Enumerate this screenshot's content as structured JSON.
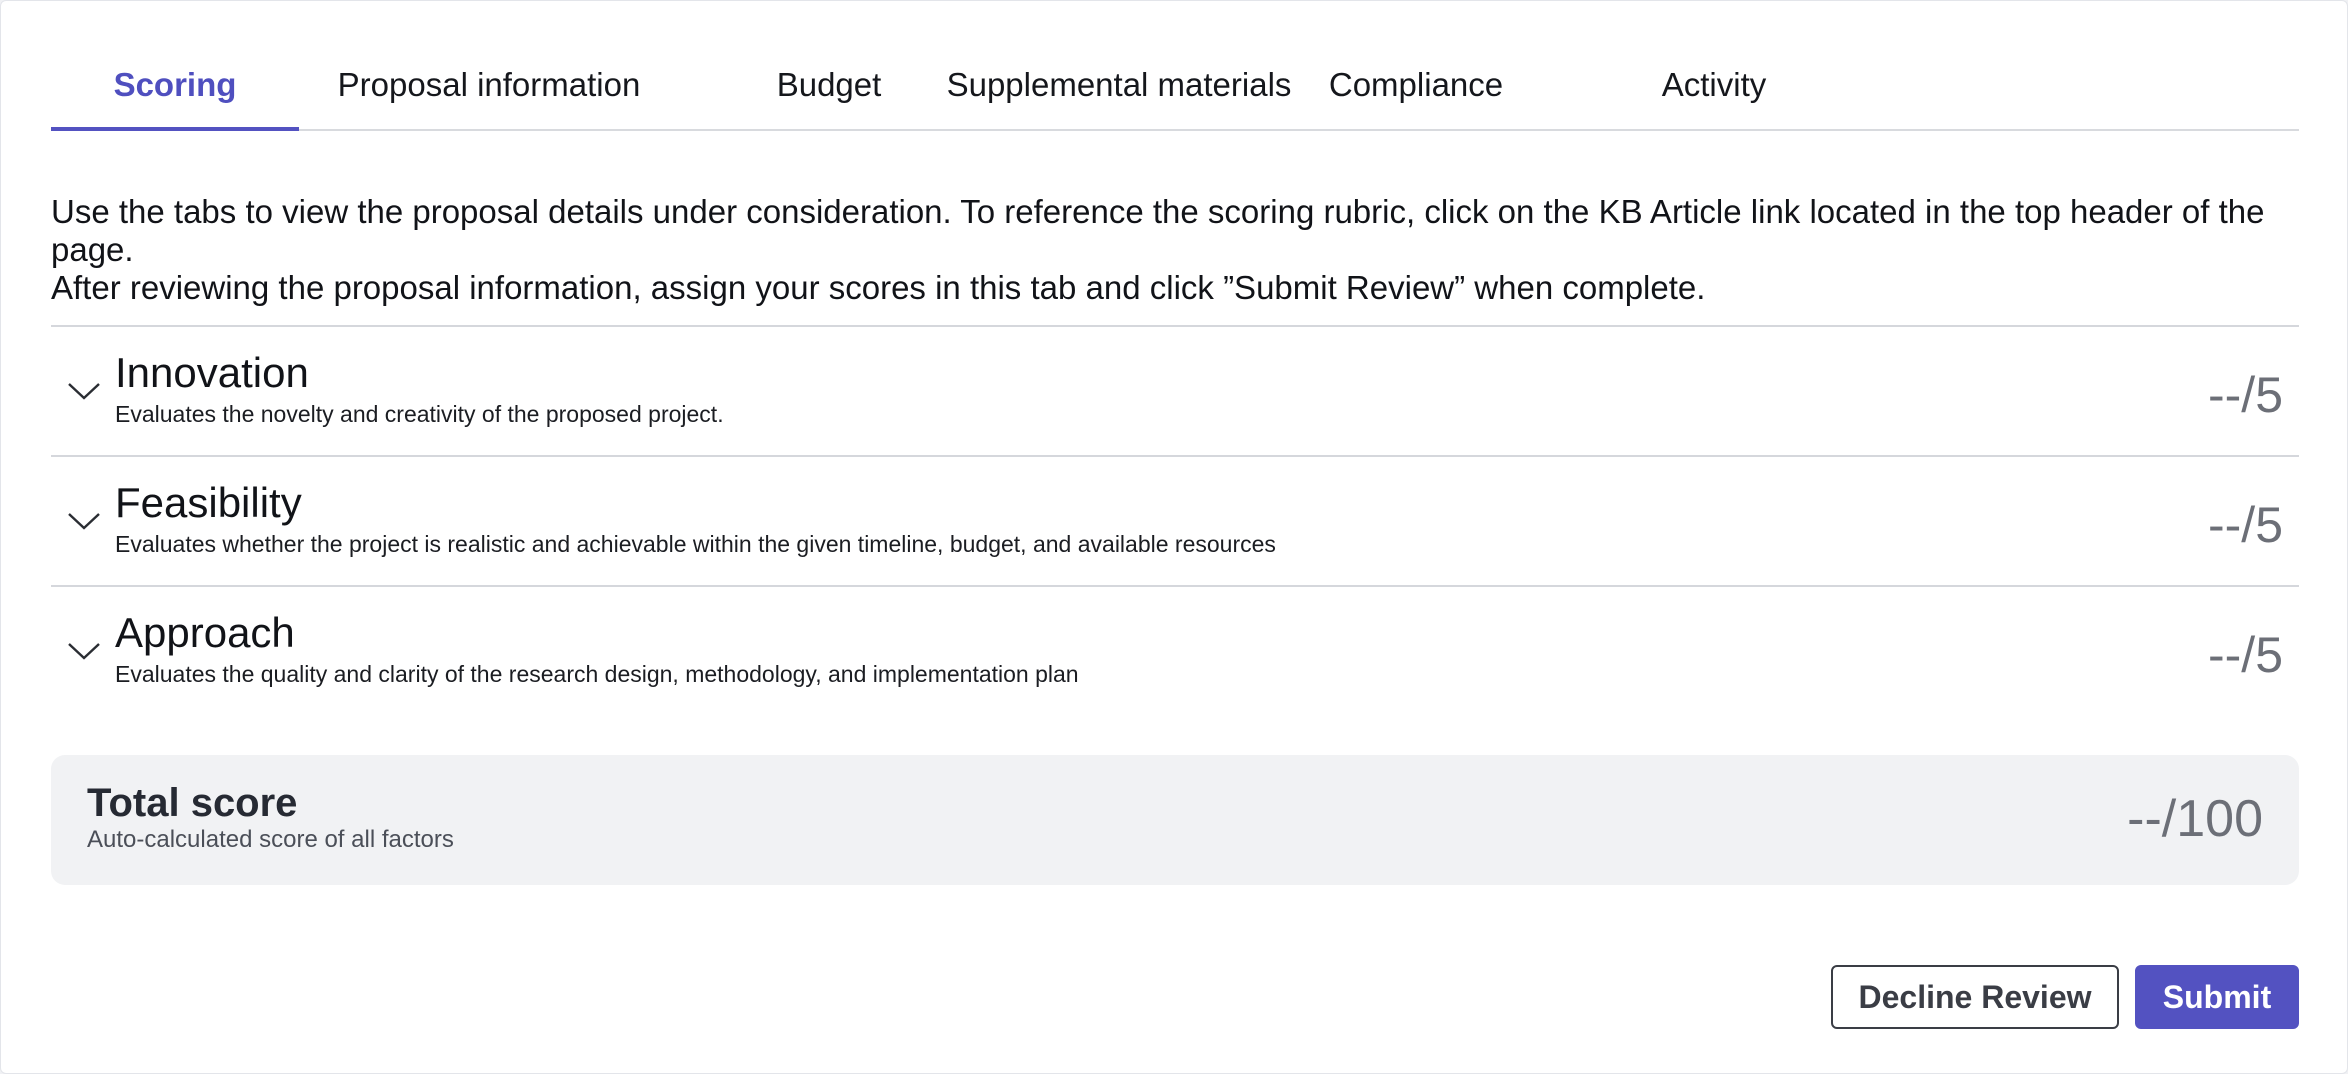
{
  "tabs": [
    {
      "label": "Scoring",
      "active": true
    },
    {
      "label": "Proposal information",
      "active": false
    },
    {
      "label": "Budget",
      "active": false
    },
    {
      "label": "Supplemental materials",
      "active": false
    },
    {
      "label": "Compliance",
      "active": false
    },
    {
      "label": "Activity",
      "active": false
    }
  ],
  "instructions": {
    "line1": "Use the tabs to view the proposal details under consideration. To reference the scoring rubric, click on the KB Article link located in the top header of the page.",
    "line2": "After reviewing the proposal information, assign your scores in this tab and click ”Submit Review” when complete."
  },
  "criteria": [
    {
      "title": "Innovation",
      "description": "Evaluates the novelty and creativity of the proposed project.",
      "score": "--/5",
      "icon": "chevron-down-icon"
    },
    {
      "title": "Feasibility",
      "description": "Evaluates whether the project is realistic and achievable within the given timeline, budget, and available resources",
      "score": "--/5",
      "icon": "chevron-down-icon"
    },
    {
      "title": "Approach",
      "description": "Evaluates the quality and clarity of the research design, methodology, and implementation plan",
      "score": "--/5",
      "icon": "chevron-down-icon"
    }
  ],
  "total": {
    "title": "Total score",
    "description": "Auto-calculated score of all factors",
    "score": "--/100"
  },
  "actions": {
    "decline_label": "Decline Review",
    "submit_label": "Submit"
  },
  "colors": {
    "accent": "#5352c1",
    "border": "#d5d7dc",
    "score_text": "#6c6f77",
    "total_background": "#f1f2f4"
  }
}
